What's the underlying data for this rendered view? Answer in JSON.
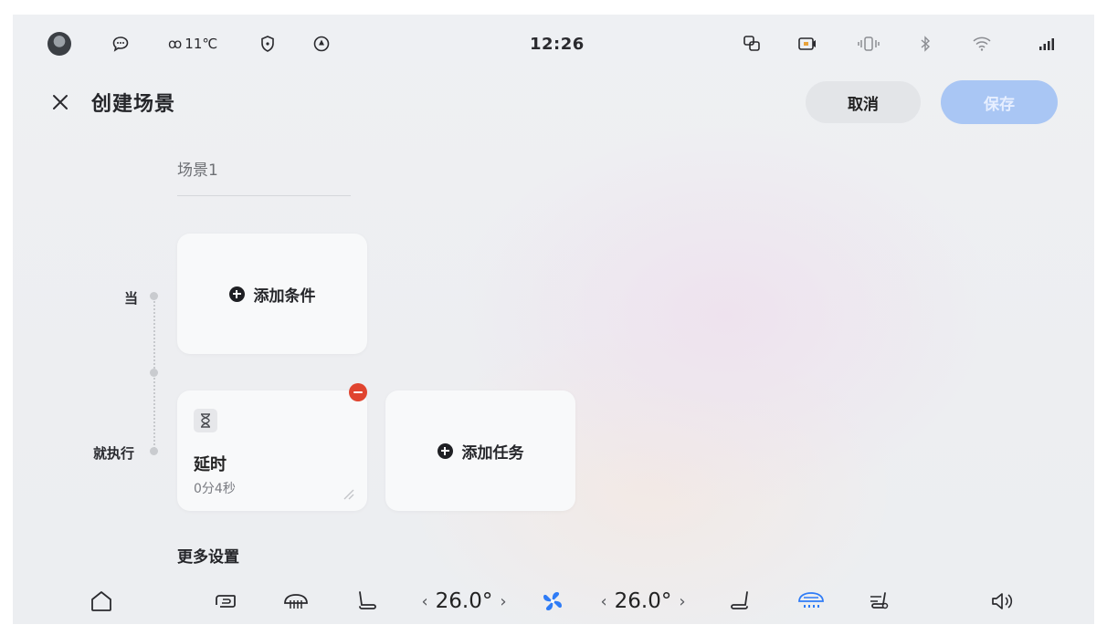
{
  "status_bar": {
    "temperature": "11℃",
    "time": "12:26",
    "icons": [
      "avatar",
      "message-icon",
      "visibility-icon",
      "shield-icon",
      "navigation-icon",
      "screen-share-icon",
      "camera-icon",
      "vibrate-icon",
      "bluetooth-icon",
      "wifi-icon",
      "signal-icon"
    ]
  },
  "header": {
    "title": "创建场景",
    "cancel_label": "取消",
    "save_label": "保存"
  },
  "scene": {
    "name": "场景1"
  },
  "timeline": {
    "when_label": "当",
    "then_label": "就执行"
  },
  "condition_card": {
    "add_label": "添加条件"
  },
  "task_card": {
    "add_label": "添加任务"
  },
  "delay_card": {
    "title": "延时",
    "value": "0分4秒"
  },
  "more_settings_label": "更多设置",
  "dock": {
    "left_temp": "26.0°",
    "right_temp": "26.0°",
    "arrow_left": "‹",
    "arrow_right": "›",
    "icons": [
      "home-icon",
      "recirculation-icon",
      "defrost-icon",
      "driver-seat-icon",
      "fan-icon",
      "passenger-seat-icon",
      "windshield-heat-icon",
      "seat-heat-icon",
      "volume-icon"
    ]
  },
  "colors": {
    "accent": "#2f7cf6",
    "save_disabled": "#a9c6f4",
    "remove": "#e0442f"
  }
}
